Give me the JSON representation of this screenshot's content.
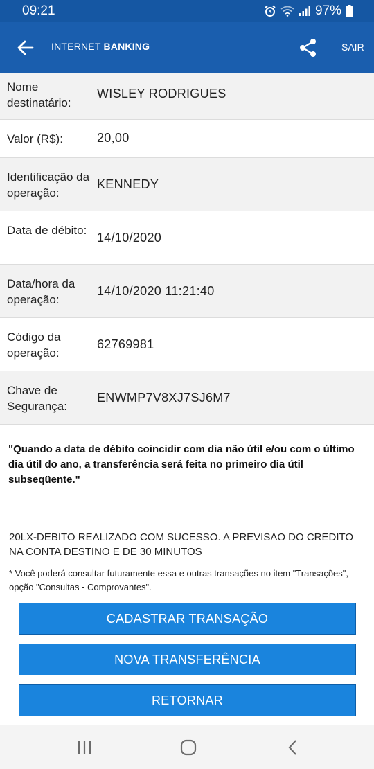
{
  "status": {
    "time": "09:21",
    "battery": "97%"
  },
  "header": {
    "title_light": "INTERNET",
    "title_bold": "BANKING",
    "exit_label": "SAIR"
  },
  "details": [
    {
      "label": "Nome destinatário:",
      "value": "WISLEY RODRIGUES"
    },
    {
      "label": "Valor (R$):",
      "value": "20,00"
    },
    {
      "label": "Identificação da operação:",
      "value": "KENNEDY"
    },
    {
      "label": "Data de débito:",
      "value": "14/10/2020"
    },
    {
      "label": "Data/hora da operação:",
      "value": "14/10/2020 11:21:40"
    },
    {
      "label": "Código da operação:",
      "value": "62769981"
    },
    {
      "label": "Chave de Segurança:",
      "value": "ENWMP7V8XJ7SJ6M7"
    }
  ],
  "notice": "\"Quando a data de débito coincidir com dia não útil e/ou com o último dia útil do ano, a transferência será feita no primeiro dia útil subseqüente.\"",
  "success_message": "20LX-DEBITO REALIZADO COM SUCESSO. A PREVISAO DO CREDITO NA CONTA DESTINO E DE 30 MINUTOS",
  "footnote": "* Você poderá consultar futuramente essa e outras transações no item \"Transações\", opção \"Consultas - Comprovantes\".",
  "buttons": {
    "register": "CADASTRAR TRANSAÇÃO",
    "new_transfer": "NOVA TRANSFERÊNCIA",
    "return": "RETORNAR"
  },
  "icons": {
    "back": "arrow-left-icon",
    "share": "share-icon",
    "nav_recent": "recent-apps-icon",
    "nav_home": "home-icon",
    "nav_back": "back-chevron-icon"
  },
  "colors": {
    "header": "#1a5eae",
    "button": "#1a84dd"
  }
}
